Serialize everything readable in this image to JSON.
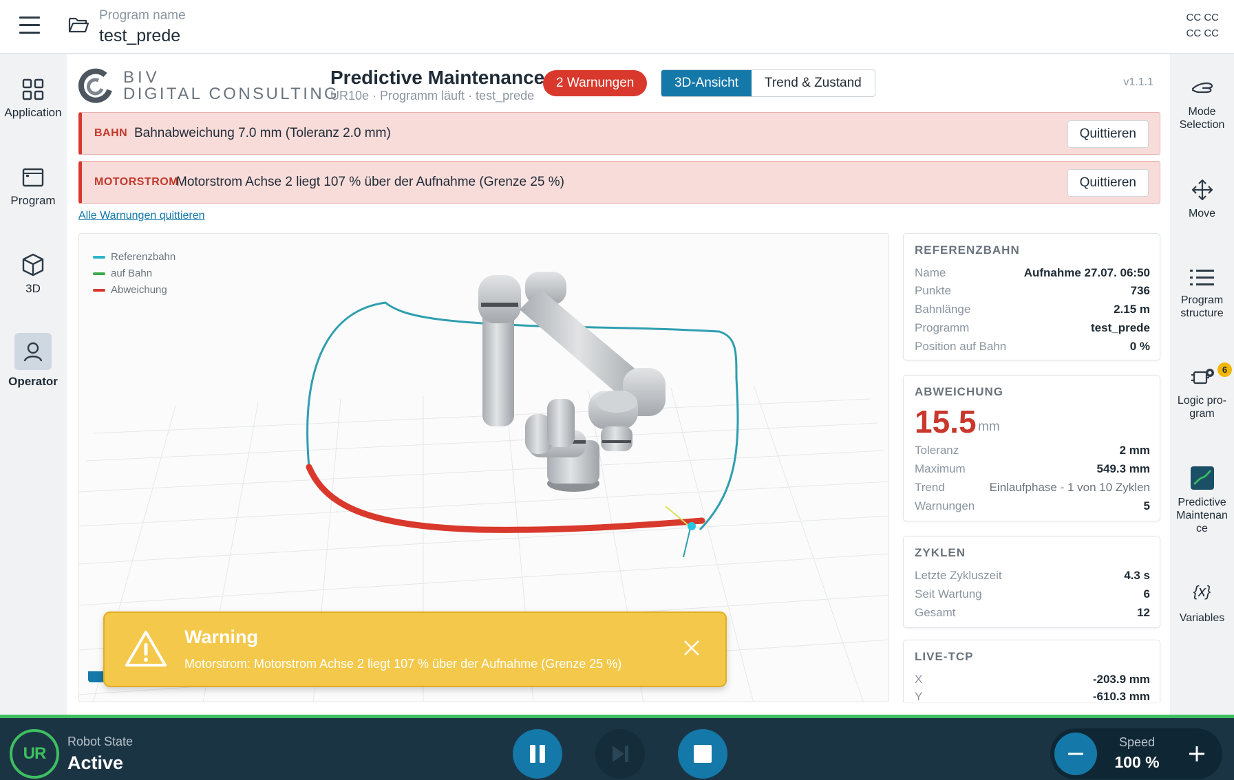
{
  "header": {
    "program_name_label": "Program name",
    "program_name": "test_prede",
    "cc_line1": "CC CC",
    "cc_line2": "CC CC"
  },
  "left_nav": [
    {
      "label": "Application",
      "icon": "grid-icon"
    },
    {
      "label": "Program",
      "icon": "window-icon"
    },
    {
      "label": "3D",
      "icon": "cube-icon"
    },
    {
      "label": "Operator",
      "icon": "user-icon",
      "active": true
    }
  ],
  "right_nav": [
    {
      "label": "Mode Selection",
      "icon": "hand-icon"
    },
    {
      "label": "Move",
      "icon": "move-arrows-icon"
    },
    {
      "label": "Program structure",
      "icon": "list-icon"
    },
    {
      "label": "Logic pro-gram",
      "icon": "logic-icon",
      "badge": "6"
    },
    {
      "label": "Predictive Maintenan ce",
      "icon": "chart-icon"
    },
    {
      "label": "Variables",
      "icon": "variables-icon",
      "glyph": "{x}"
    }
  ],
  "app": {
    "logo_line1": "BIV",
    "logo_line2": "DIGITAL CONSULTING",
    "title": "Predictive Maintenance",
    "subtitle": "UR10e · Programm läuft · test_prede",
    "warnings_pill": "2 Warnungen",
    "tabs": [
      "3D-Ansicht",
      "Trend & Zustand"
    ],
    "active_tab": "3D-Ansicht",
    "version": "v1.1.1"
  },
  "alerts": [
    {
      "tag": "BAHN",
      "message": "Bahnabweichung 7.0 mm (Toleranz 2.0 mm)",
      "button": "Quittieren"
    },
    {
      "tag": "MOTORSTROM",
      "message": "Motorstrom Achse 2 liegt 107 % über der Aufnahme (Grenze 25 %)",
      "button": "Quittieren"
    }
  ],
  "ack_all": "Alle Warnungen quittieren",
  "legend": [
    {
      "label": "Referenzbahn",
      "color": "#2eb5c8"
    },
    {
      "label": "auf Bahn",
      "color": "#3aa94a"
    },
    {
      "label": "Abweichung",
      "color": "#d8392c"
    }
  ],
  "toast": {
    "title": "Warning",
    "message": "Motorstrom: Motorstrom Achse 2 liegt 107 % über der Aufnahme (Grenze 25 %)"
  },
  "cards": {
    "referenzbahn": {
      "title": "REFERENZBAHN",
      "rows": [
        {
          "k": "Name",
          "v": "Aufnahme 27.07. 06:50"
        },
        {
          "k": "Punkte",
          "v": "736"
        },
        {
          "k": "Bahnlänge",
          "v": "2.15 m"
        },
        {
          "k": "Programm",
          "v": "test_prede"
        },
        {
          "k": "Position auf Bahn",
          "v": "0 %"
        }
      ]
    },
    "abweichung": {
      "title": "ABWEICHUNG",
      "value": "15.5",
      "unit": "mm",
      "rows": [
        {
          "k": "Toleranz",
          "v": "2 mm"
        },
        {
          "k": "Maximum",
          "v": "549.3 mm"
        },
        {
          "k": "Trend",
          "v": "Einlaufphase - 1 von 10 Zyklen"
        },
        {
          "k": "Warnungen",
          "v": "5"
        }
      ]
    },
    "zyklen": {
      "title": "ZYKLEN",
      "rows": [
        {
          "k": "Letzte Zykluszeit",
          "v": "4.3 s"
        },
        {
          "k": "Seit Wartung",
          "v": "6"
        },
        {
          "k": "Gesamt",
          "v": "12"
        }
      ]
    },
    "livetcp": {
      "title": "LIVE-TCP",
      "rows": [
        {
          "k": "X",
          "v": "-203.9 mm"
        },
        {
          "k": "Y",
          "v": "-610.3 mm"
        }
      ]
    }
  },
  "bottom": {
    "logo_text": "UR",
    "robot_state_label": "Robot State",
    "robot_state": "Active",
    "speed_label": "Speed",
    "speed_value": "100 %"
  }
}
